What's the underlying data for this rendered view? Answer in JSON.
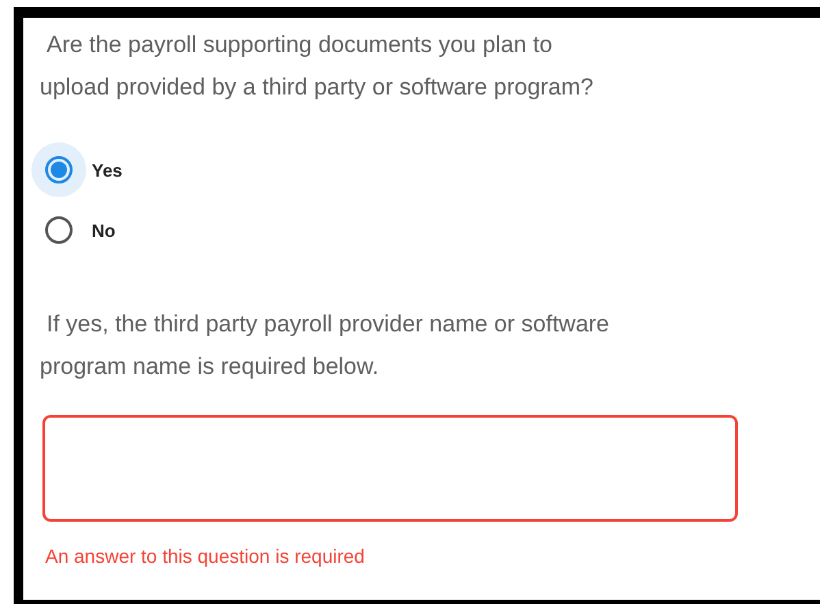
{
  "question": {
    "text": "Are the payroll supporting documents you plan to upload provided by a third party or software program?",
    "options": [
      {
        "label": "Yes",
        "selected": true
      },
      {
        "label": "No",
        "selected": false
      }
    ]
  },
  "followup": {
    "text": "If yes, the third party payroll provider name or software program name is required below.",
    "invalid": true,
    "error": "An answer to this question is required"
  }
}
